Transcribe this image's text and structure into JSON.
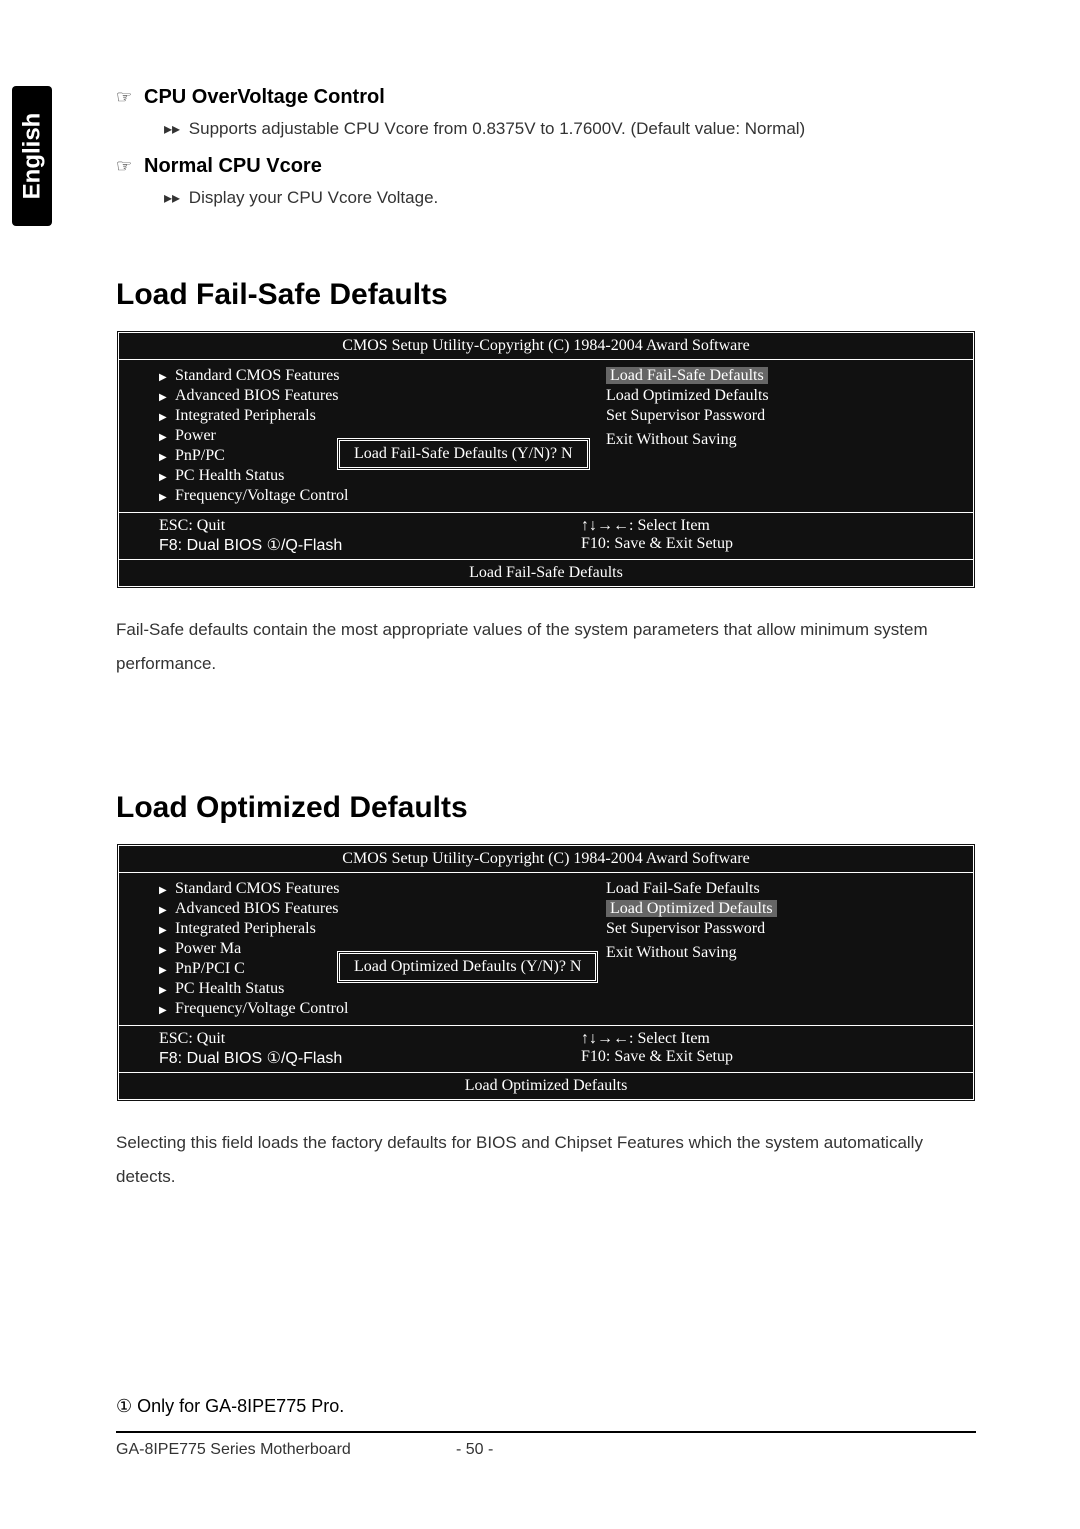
{
  "sidebar": {
    "language": "English"
  },
  "intro": {
    "item1_title": "CPU OverVoltage Control",
    "item1_desc": "Supports adjustable CPU Vcore from 0.8375V to 1.7600V. (Default value: Normal)",
    "item2_title": "Normal CPU Vcore",
    "item2_desc": "Display your CPU Vcore Voltage."
  },
  "section1": {
    "heading": "Load Fail-Safe Defaults",
    "bios": {
      "title": "CMOS Setup Utility-Copyright (C) 1984-2004 Award Software",
      "left_items": [
        "Standard CMOS Features",
        "Advanced BIOS Features",
        "Integrated Peripherals",
        "Power",
        "PnP/PC",
        "PC Health Status",
        "Frequency/Voltage Control"
      ],
      "right_items": [
        "Load Fail-Safe Defaults",
        "Load Optimized Defaults",
        "Set Supervisor Password",
        "",
        "",
        "Exit Without Saving"
      ],
      "highlight_index_right": 0,
      "dialog_text": "Load Fail-Safe Defaults (Y/N)? N",
      "keys_left": [
        "ESC: Quit",
        "F8: Dual BIOS ①/Q-Flash"
      ],
      "keys_right": [
        "↑↓→←: Select Item",
        "F10: Save & Exit Setup"
      ],
      "footer": "Load Fail-Safe Defaults"
    },
    "description": "Fail-Safe defaults contain the most appropriate values of the system parameters that allow minimum system performance."
  },
  "section2": {
    "heading": "Load Optimized Defaults",
    "bios": {
      "title": "CMOS Setup Utility-Copyright (C) 1984-2004 Award Software",
      "left_items": [
        "Standard CMOS Features",
        "Advanced BIOS Features",
        "Integrated Peripherals",
        "Power Ma",
        "PnP/PCI C",
        "PC Health Status",
        "Frequency/Voltage Control"
      ],
      "right_items": [
        "Load Fail-Safe Defaults",
        "Load Optimized Defaults",
        "Set Supervisor Password",
        "",
        "",
        "Exit Without Saving"
      ],
      "highlight_index_right": 1,
      "dialog_text": "Load Optimized Defaults (Y/N)? N",
      "keys_left": [
        "ESC: Quit",
        "F8: Dual BIOS ①/Q-Flash"
      ],
      "keys_right": [
        "↑↓→←: Select Item",
        "F10: Save & Exit Setup"
      ],
      "footer": "Load Optimized Defaults"
    },
    "description": "Selecting this field loads the factory defaults for BIOS and Chipset Features which the system automatically detects."
  },
  "footer": {
    "note": "① Only for GA-8IPE775 Pro.",
    "model": "GA-8IPE775 Series Motherboard",
    "page": "- 50 -"
  }
}
